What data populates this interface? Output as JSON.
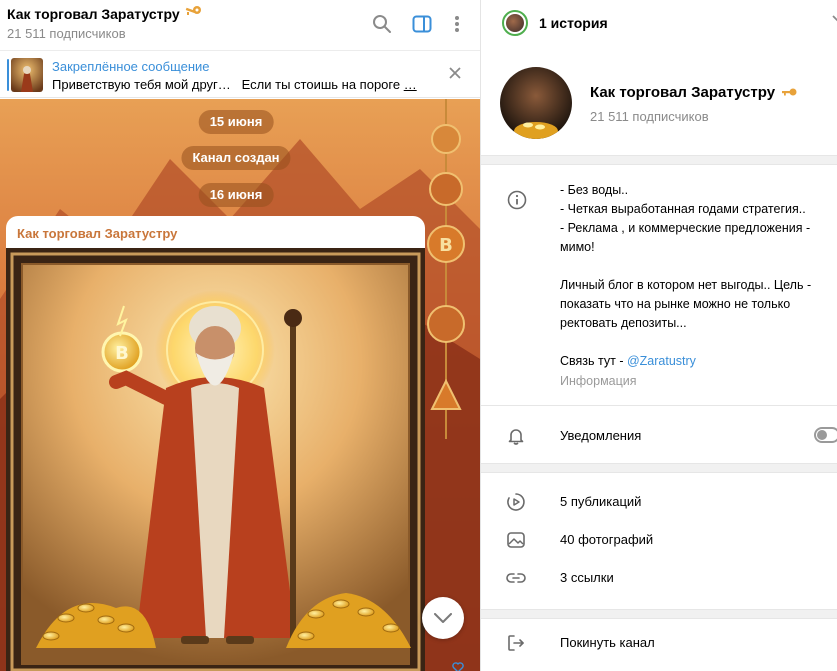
{
  "chat": {
    "title": "Как торговал Заратустру",
    "subscribers": "21 511 подписчиков"
  },
  "pinned": {
    "title": "Закреплённое сообщение",
    "text_start": "Приветствую тебя мой друг…",
    "text_rest": "Если ты стоишь на пороге ",
    "text_more": "…"
  },
  "dates": [
    {
      "label": "15 июня"
    },
    {
      "label": "Канал создан"
    },
    {
      "label": "16 июня"
    }
  ],
  "message": {
    "author": "Как торговал Заратустру"
  },
  "profile": {
    "stories_label": "1 история",
    "name": "Как торговал Заратустру",
    "subscribers": "21 511 подписчиков",
    "description_lines": [
      "- Без воды..",
      "- Четкая выработанная годами стратегия..",
      "- Реклама , и коммерческие предложения - мимо!",
      "",
      "Личный блог в котором нет выгоды.. Цель - показать что на рынке можно не только ректовать депозиты..."
    ],
    "contact_prefix": "Связь тут - ",
    "contact_link": "@Zaratustry",
    "description_caption": "Информация",
    "notifications_label": "Уведомления",
    "notifications_on": false,
    "media": [
      {
        "icon": "video-icon",
        "label": "5 публикаций"
      },
      {
        "icon": "photo-icon",
        "label": "40 фотографий"
      },
      {
        "icon": "link-icon",
        "label": "3 ссылки"
      }
    ],
    "leave_label": "Покинуть канал"
  },
  "colors": {
    "accent": "#3a8fd9",
    "author": "#c9763a",
    "story_ring": "#4fae4e"
  }
}
